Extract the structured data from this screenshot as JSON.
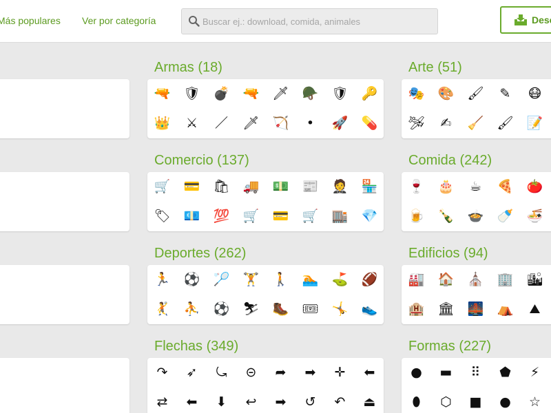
{
  "header": {
    "nav_popular": "Más populares",
    "nav_category": "Ver por categoría",
    "search_placeholder": "Buscar ej.: download, comida, animales",
    "download_label": "Descargar"
  },
  "colors": {
    "accent": "#6aab2c",
    "link": "#5b9a1f",
    "background": "#e9e9e9"
  },
  "sections": [
    {
      "id": "left1",
      "title": "",
      "icons": [
        [
          "❗",
          "running-person-icon"
        ],
        [
          "🏃",
          "runner-icon"
        ],
        [
          "🦩",
          "flamingo-icon"
        ],
        [
          "🐦",
          "bird-icon"
        ],
        [
          "🕑",
          "clock-icon"
        ],
        [
          "🐎",
          "horse-icon"
        ],
        [
          "🔍",
          "magnifier-icon"
        ],
        [
          "🦋",
          "butterfly-icon"
        ],
        [
          "🐾",
          "paw-icon"
        ],
        [
          "🐟",
          "fish-icon"
        ]
      ]
    },
    {
      "id": "armas",
      "title": "Armas (18)",
      "icons": [
        [
          "🔫",
          "pistol-icon"
        ],
        [
          "🛡",
          "shield-icon"
        ],
        [
          "💣",
          "grenade-icon"
        ],
        [
          "🔫",
          "handgun-icon"
        ],
        [
          "🗡",
          "knife-icon"
        ],
        [
          "🪖",
          "helmet-icon"
        ],
        [
          "🛡",
          "badge-shield-icon"
        ],
        [
          "🔑",
          "bullet-icon"
        ],
        [
          "👑",
          "crown-icon"
        ],
        [
          "⚔",
          "crossed-swords-icon"
        ],
        [
          "／",
          "sword-icon"
        ],
        [
          "🗡",
          "rifle-icon"
        ],
        [
          "🏹",
          "mortar-icon"
        ],
        [
          "•",
          "bullet-point-icon"
        ],
        [
          "🚀",
          "missile-icon"
        ],
        [
          "💊",
          "torpedo-icon"
        ]
      ]
    },
    {
      "id": "arte",
      "title": "Arte (51)",
      "icons": [
        [
          "🎭",
          "theater-masks-icon"
        ],
        [
          "🎨",
          "palette-icon"
        ],
        [
          "🖌",
          "paintbrush-icon"
        ],
        [
          "✎",
          "pencil-icon"
        ],
        [
          "😷",
          "mask-icon"
        ],
        [
          "🛩",
          "paper-plane-icon"
        ],
        [
          "✍",
          "writing-icon"
        ],
        [
          "🧹",
          "eraser-icon"
        ],
        [
          "🖌",
          "brush-icon"
        ],
        [
          "📝",
          "edit-icon"
        ]
      ]
    },
    {
      "id": "left2",
      "title": "",
      "icons": [
        [
          "🎥",
          "camera-icon"
        ],
        [
          "📺",
          "screen-icon"
        ],
        [
          "📽",
          "projector-icon"
        ],
        [
          "🎟",
          "ticket-icon"
        ],
        [
          "🎞",
          "film-strip-icon"
        ],
        [
          "🗑",
          "trash-icon"
        ],
        [
          "▶",
          "play-icon"
        ],
        [
          "📹",
          "video-camera-icon"
        ],
        [
          "🎬",
          "clapperboard-icon"
        ],
        [
          "★",
          "star-icon"
        ]
      ]
    },
    {
      "id": "comercio",
      "title": "Comercio (137)",
      "icons": [
        [
          "🛒",
          "hand-truck-icon"
        ],
        [
          "💳",
          "credit-card-icon"
        ],
        [
          "🛍",
          "shopping-bag-icon"
        ],
        [
          "🚚",
          "delivery-truck-icon"
        ],
        [
          "💵",
          "cash-icon"
        ],
        [
          "📰",
          "newspaper-icon"
        ],
        [
          "🤵",
          "businessman-icon"
        ],
        [
          "🏪",
          "store-icon"
        ],
        [
          "🏷",
          "tag-icon"
        ],
        [
          "💶",
          "bills-icon"
        ],
        [
          "💯",
          "percent-icon"
        ],
        [
          "🛒",
          "cart-icon"
        ],
        [
          "💳",
          "card-icon"
        ],
        [
          "🛒",
          "shopping-cart-icon"
        ],
        [
          "🏬",
          "shop-awning-icon"
        ],
        [
          "💎",
          "diamond-icon"
        ]
      ]
    },
    {
      "id": "comida",
      "title": "Comida (242)",
      "icons": [
        [
          "🍷",
          "wine-glass-icon"
        ],
        [
          "🎂",
          "cake-icon"
        ],
        [
          "☕",
          "tea-cup-icon"
        ],
        [
          "🍕",
          "pizza-icon"
        ],
        [
          "🍅",
          "tomato-icon"
        ],
        [
          "🍺",
          "mug-icon"
        ],
        [
          "🍾",
          "wine-bottle-icon"
        ],
        [
          "🍲",
          "cooking-pot-icon"
        ],
        [
          "🍼",
          "bottle-icon"
        ],
        [
          "🍜",
          "bowl-icon"
        ]
      ]
    },
    {
      "id": "left3",
      "title": "",
      "icons": [
        [
          "✖",
          "close-icon"
        ],
        [
          "⛶",
          "expand-icon"
        ],
        [
          "↻",
          "refresh-icon"
        ],
        [
          "⤡",
          "compress-icon"
        ],
        [
          "🎤",
          "microphone-icon"
        ],
        [
          "⏸",
          "pause-icon"
        ],
        [
          "🔇",
          "mute-icon"
        ],
        [
          "👆",
          "pointer-hand-icon"
        ],
        [
          "☝",
          "tap-hand-icon"
        ],
        [
          "👓",
          "glasses-icon"
        ]
      ]
    },
    {
      "id": "deportes",
      "title": "Deportes (262)",
      "icons": [
        [
          "🏃",
          "running-icon"
        ],
        [
          "⚽",
          "soccer-icon"
        ],
        [
          "🏸",
          "badminton-icon"
        ],
        [
          "🏋",
          "weightlifting-icon"
        ],
        [
          "🚶",
          "walking-icon"
        ],
        [
          "🏊",
          "swimming-icon"
        ],
        [
          "⛳",
          "golf-flag-icon"
        ],
        [
          "🏈",
          "football-icon"
        ],
        [
          "🤾",
          "diving-icon"
        ],
        [
          "⛹",
          "player-icon"
        ],
        [
          "⚽",
          "ball-icon"
        ],
        [
          "⛷",
          "skiing-icon"
        ],
        [
          "🥾",
          "hiking-icon"
        ],
        [
          "🎟",
          "ticket-icon"
        ],
        [
          "🤸",
          "gymnast-icon"
        ],
        [
          "👟",
          "sneaker-icon"
        ]
      ]
    },
    {
      "id": "edificios",
      "title": "Edificios (94)",
      "icons": [
        [
          "🏭",
          "factory-icon"
        ],
        [
          "🏠",
          "house-icon"
        ],
        [
          "⛪",
          "church-icon"
        ],
        [
          "🏢",
          "office-icon"
        ],
        [
          "🏙",
          "skyscraper-icon"
        ],
        [
          "🏨",
          "hotel-icon"
        ],
        [
          "🏛",
          "museum-icon"
        ],
        [
          "🌉",
          "bridge-icon"
        ],
        [
          "⛺",
          "tent-icon"
        ],
        [
          "⛰",
          "mountain-icon"
        ]
      ]
    },
    {
      "id": "left4",
      "title": "",
      "icons": [
        [
          "📐",
          "ruler-icon"
        ],
        [
          "📖",
          "book-icon"
        ],
        [
          "🎓",
          "graduation-cap-icon"
        ],
        [
          "📜",
          "scroll-icon"
        ],
        [
          "👨",
          "teacher-icon"
        ],
        [
          "🏫",
          "school-icon"
        ],
        [
          "⚛",
          "atom-icon"
        ],
        [
          "🎓",
          "mortarboard-icon"
        ],
        [
          "🖥",
          "presentation-icon"
        ],
        [
          "∑",
          "formula-icon"
        ]
      ]
    },
    {
      "id": "flechas",
      "title": "Flechas (349)",
      "icons": [
        [
          "↷",
          "curved-arrow-icon"
        ],
        [
          "➶",
          "navigation-arrow-icon"
        ],
        [
          "⤿",
          "u-turn-icon"
        ],
        [
          "⊝",
          "arrow-circle-icon"
        ],
        [
          "➦",
          "forward-arrow-icon"
        ],
        [
          "➡",
          "right-arrow-icon"
        ],
        [
          "✛",
          "move-icon"
        ],
        [
          "⬅",
          "left-arrow-icon"
        ],
        [
          "⇄",
          "swap-arrows-icon"
        ],
        [
          "⬅",
          "arrow-left-circle-icon"
        ],
        [
          "⬇",
          "down-arrow-icon"
        ],
        [
          "↩",
          "reply-icon"
        ],
        [
          "➡",
          "arrow-right-icon"
        ],
        [
          "↺",
          "undo-icon"
        ],
        [
          "↶",
          "back-arrow-icon"
        ],
        [
          "⏏",
          "exit-icon"
        ]
      ]
    },
    {
      "id": "formas",
      "title": "Formas (227)",
      "icons": [
        [
          "●",
          "circle-icon"
        ],
        [
          "▬",
          "rectangle-icon"
        ],
        [
          "⠿",
          "dots-grid-icon"
        ],
        [
          "⬟",
          "shield-shape-icon"
        ],
        [
          "⚡",
          "lightning-icon"
        ],
        [
          "⬮",
          "ellipse-icon"
        ],
        [
          "⬡",
          "hexagons-icon"
        ],
        [
          "■",
          "square-icon"
        ],
        [
          "●",
          "filled-circle-icon"
        ],
        [
          "☆",
          "star-outline-icon"
        ]
      ]
    }
  ]
}
